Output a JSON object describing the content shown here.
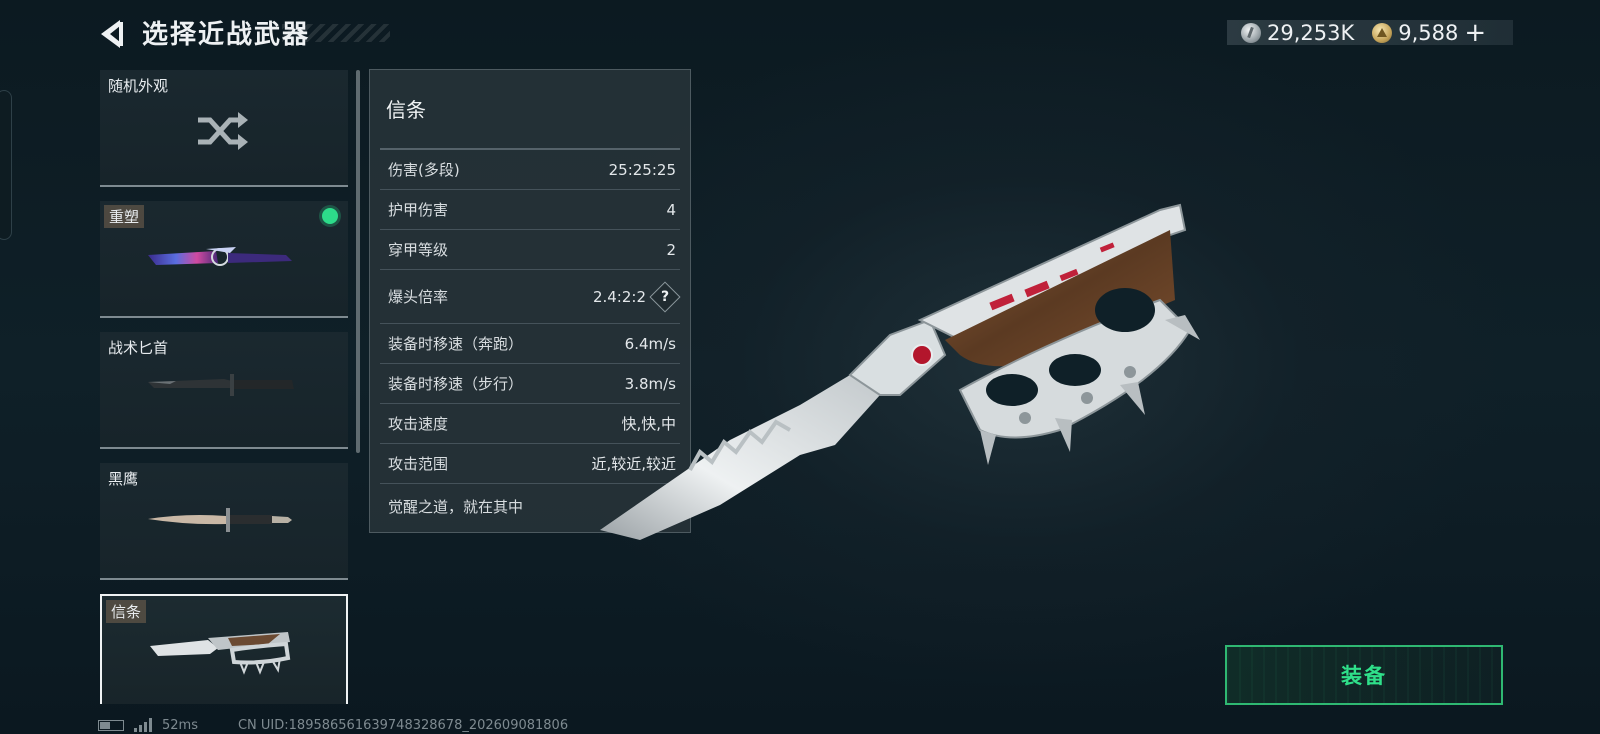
{
  "header": {
    "title": "选择近战武器",
    "currency": [
      {
        "icon": "silver-coin-icon",
        "amount": "29,253K"
      },
      {
        "icon": "gold-coin-icon",
        "amount": "9,588"
      }
    ],
    "add_label": "+"
  },
  "weapon_list": {
    "items": [
      {
        "label": "随机外观",
        "icon": "shuffle-icon"
      },
      {
        "label": "重塑",
        "equipped": true
      },
      {
        "label": "战术匕首"
      },
      {
        "label": "黑鹰"
      },
      {
        "label": "信条",
        "selected": true
      }
    ]
  },
  "detail": {
    "name": "信条",
    "stats": [
      {
        "label": "伤害(多段)",
        "value": "25:25:25"
      },
      {
        "label": "护甲伤害",
        "value": "4"
      },
      {
        "label": "穿甲等级",
        "value": "2"
      },
      {
        "label": "爆头倍率",
        "value": "2.4:2:2",
        "help": "?"
      },
      {
        "label": "装备时移速（奔跑）",
        "value": "6.4m/s"
      },
      {
        "label": "装备时移速（步行）",
        "value": "3.8m/s"
      },
      {
        "label": "攻击速度",
        "value": "快,快,中"
      },
      {
        "label": "攻击范围",
        "value": "近,较近,较近"
      }
    ],
    "flavor": "觉醒之道，就在其中"
  },
  "equip_button": {
    "label": "装备"
  },
  "status": {
    "ping": "52ms",
    "uid": "CN UID:18958656163974832867​8_202609081806"
  },
  "colors": {
    "accent_green": "#2fe08a",
    "equipped_dot": "#2ddc8a",
    "panel_bg": "#263238"
  }
}
